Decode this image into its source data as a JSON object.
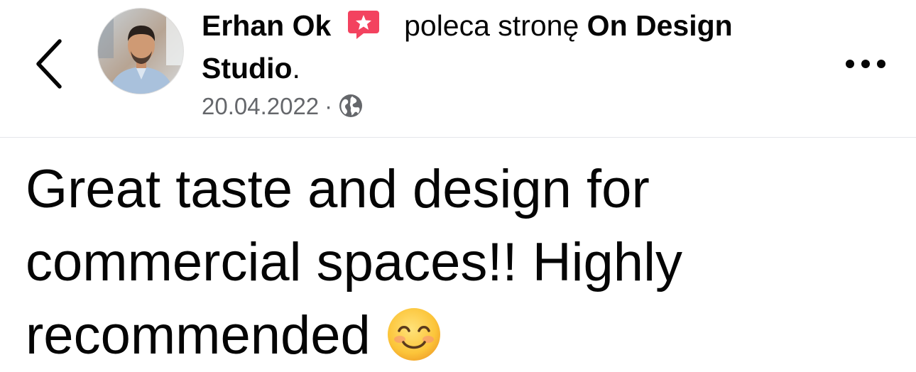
{
  "header": {
    "author_name": "Erhan Ok",
    "recommend_icon": "recommendation-star-icon",
    "action_text": "poleca stronę",
    "page_name_line1": "On Design",
    "page_name_line2": "Studio",
    "page_name_suffix": ".",
    "date": "20.04.2022",
    "separator": "·",
    "privacy_icon": "globe-icon",
    "back_icon": "chevron-left-icon",
    "more_icon": "more-horizontal-icon"
  },
  "post": {
    "text_line1": "Great taste and design for",
    "text_line2": "commercial spaces!!  Highly",
    "text_line3": "recommended",
    "emoji": "smiling-face-emoji"
  },
  "colors": {
    "text_primary": "#050505",
    "text_secondary": "#65676b",
    "recommend_accent": "#f3425f",
    "divider": "#e4e6eb"
  }
}
